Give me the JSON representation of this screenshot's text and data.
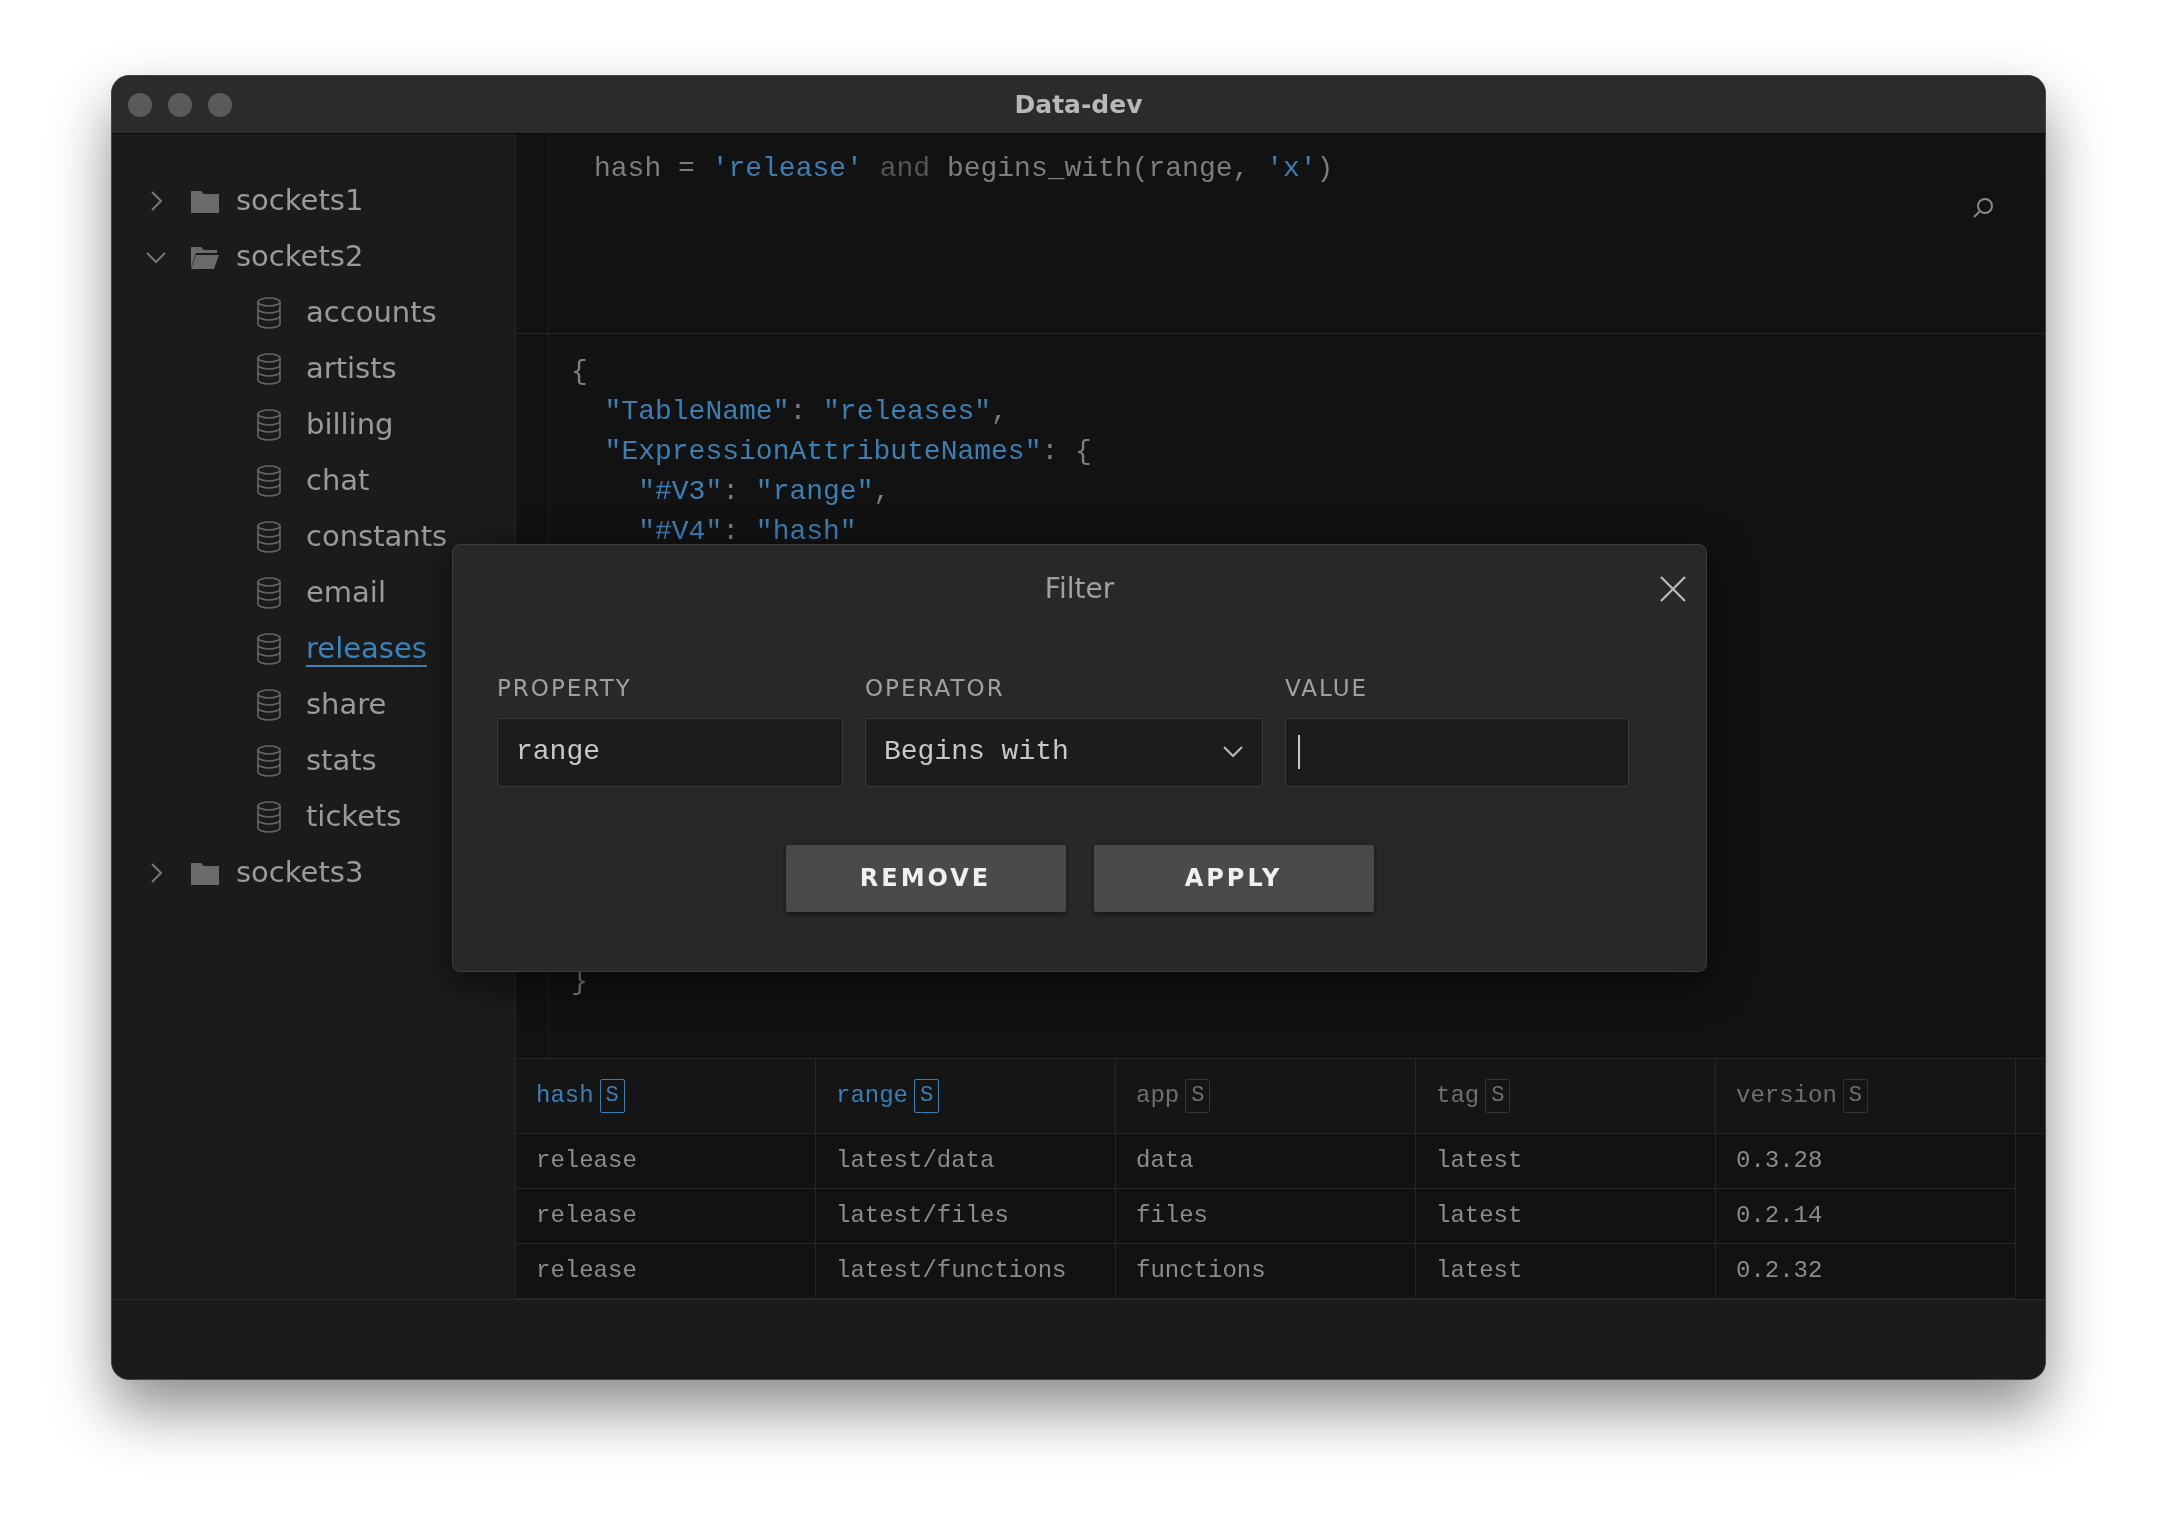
{
  "window": {
    "title": "Data-dev"
  },
  "tree": [
    {
      "label": "sockets1",
      "expanded": false
    },
    {
      "label": "sockets2",
      "expanded": true,
      "children": [
        {
          "label": "accounts",
          "selected": false
        },
        {
          "label": "artists",
          "selected": false
        },
        {
          "label": "billing",
          "selected": false
        },
        {
          "label": "chat",
          "selected": false
        },
        {
          "label": "constants",
          "selected": false
        },
        {
          "label": "email",
          "selected": false
        },
        {
          "label": "releases",
          "selected": true
        },
        {
          "label": "share",
          "selected": false
        },
        {
          "label": "stats",
          "selected": false
        },
        {
          "label": "tickets",
          "selected": false
        }
      ]
    },
    {
      "label": "sockets3",
      "expanded": false
    }
  ],
  "query": [
    {
      "kind": "plain",
      "text": "hash = "
    },
    {
      "kind": "string",
      "text": "'release'"
    },
    {
      "kind": "keyword",
      "text": " and "
    },
    {
      "kind": "plain",
      "text": "begins_with(range, "
    },
    {
      "kind": "string",
      "text": "'x'"
    },
    {
      "kind": "plain",
      "text": ")"
    }
  ],
  "request_json": {
    "lines": [
      [
        {
          "kind": "punct",
          "text": "{"
        }
      ],
      [
        {
          "kind": "key",
          "text": "  \"TableName\""
        },
        {
          "kind": "punct",
          "text": ": "
        },
        {
          "kind": "string",
          "text": "\"releases\""
        },
        {
          "kind": "punct",
          "text": ","
        }
      ],
      [
        {
          "kind": "key",
          "text": "  \"ExpressionAttributeNames\""
        },
        {
          "kind": "punct",
          "text": ": {"
        }
      ],
      [
        {
          "kind": "key",
          "text": "    \"#V3\""
        },
        {
          "kind": "punct",
          "text": ": "
        },
        {
          "kind": "string",
          "text": "\"range\""
        },
        {
          "kind": "punct",
          "text": ","
        }
      ],
      [
        {
          "kind": "key",
          "text": "    \"#V4\""
        },
        {
          "kind": "punct",
          "text": ": "
        },
        {
          "kind": "string",
          "text": "\"hash\""
        }
      ]
    ],
    "closing": "}"
  },
  "table": {
    "columns": [
      {
        "name": "hash",
        "type": "S",
        "key": true
      },
      {
        "name": "range",
        "type": "S",
        "key": true
      },
      {
        "name": "app",
        "type": "S",
        "key": false
      },
      {
        "name": "tag",
        "type": "S",
        "key": false
      },
      {
        "name": "version",
        "type": "S",
        "key": false
      }
    ],
    "rows": [
      [
        "release",
        "latest/data",
        "data",
        "latest",
        "0.3.28"
      ],
      [
        "release",
        "latest/files",
        "files",
        "latest",
        "0.2.14"
      ],
      [
        "release",
        "latest/functions",
        "functions",
        "latest",
        "0.2.32"
      ]
    ]
  },
  "filter_dialog": {
    "title": "Filter",
    "property": {
      "label": "PROPERTY",
      "value": "range"
    },
    "operator": {
      "label": "OPERATOR",
      "value": "Begins with"
    },
    "value": {
      "label": "VALUE",
      "focused": true
    },
    "buttons": [
      "REMOVE",
      "APPLY"
    ]
  }
}
